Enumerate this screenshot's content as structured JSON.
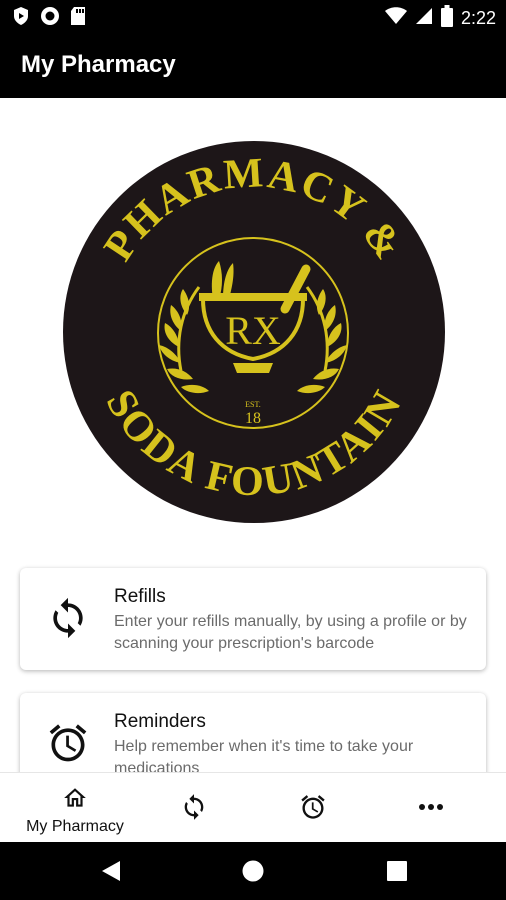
{
  "status_bar": {
    "time": "2:22",
    "left_icons": [
      "shield-play-icon",
      "circle-record-icon",
      "sd-card-icon"
    ],
    "right_icons": [
      "wifi-icon",
      "cell-signal-icon",
      "battery-icon"
    ]
  },
  "app_bar": {
    "title": "My Pharmacy"
  },
  "logo": {
    "top_text": "PHARMACY &",
    "bottom_text": "SODA FOUNTAIN",
    "center_text": "RX",
    "est_text": "EST.",
    "year_text": "18",
    "colors": {
      "background": "#1d1618",
      "gold": "#d6c21d"
    }
  },
  "cards": [
    {
      "title": "Refills",
      "description": "Enter your refills manually, by using a profile or by scanning your prescription's barcode",
      "icon": "refresh-icon"
    },
    {
      "title": "Reminders",
      "description": "Help remember when it's time to take your medications",
      "icon": "alarm-clock-icon"
    }
  ],
  "bottom_nav": {
    "items": [
      {
        "label": "My Pharmacy",
        "icon": "home-icon"
      },
      {
        "icon": "refresh-icon"
      },
      {
        "icon": "alarm-clock-icon"
      },
      {
        "icon": "more-icon"
      }
    ]
  },
  "system_nav": {
    "icons": [
      "back-icon",
      "home-circle-icon",
      "recents-icon"
    ]
  }
}
